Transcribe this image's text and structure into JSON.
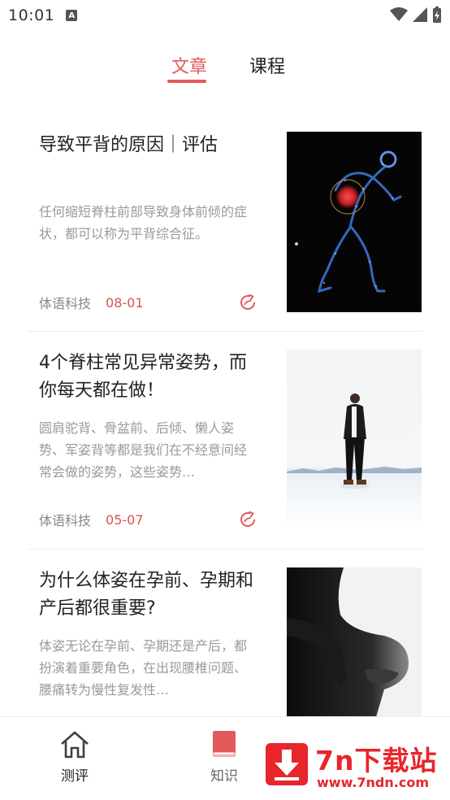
{
  "status_bar": {
    "time": "10:01",
    "notification_letter": "A"
  },
  "tabs": [
    {
      "label": "文章",
      "active": true
    },
    {
      "label": "课程",
      "active": false
    }
  ],
  "articles": [
    {
      "title": "导致平背的原因｜评估",
      "description": "任何缩短脊柱前部导致身体前倾的症状，都可以称为平背综合征。",
      "source": "体语科技",
      "date": "08-01",
      "thumbnail": "glowing-body-anatomy-image"
    },
    {
      "title": "4个脊柱常见异常姿势，而你每天都在做！",
      "description": "圆肩驼背、骨盆前、后倾、懒人姿势、军姿背等都是我们在不经意间经常会做的姿势，这些姿势…",
      "source": "体语科技",
      "date": "05-07",
      "thumbnail": "man-standing-on-snow-image"
    },
    {
      "title": "为什么体姿在孕前、孕期和产后都很重要?",
      "description": "体姿无论在孕前、孕期还是产后，都扮演着重要角色，在出现腰椎问题、腰痛转为慢性复发性…",
      "source": "",
      "date": "",
      "thumbnail": "pregnant-silhouette-image"
    }
  ],
  "bottom_nav": [
    {
      "label": "测评",
      "icon": "home-icon"
    },
    {
      "label": "知识",
      "icon": "book-icon"
    }
  ],
  "watermark": {
    "text": "7n下载站",
    "url": "www.7ndn.com"
  },
  "colors": {
    "accent": "#e25a5a",
    "date": "#d9534f",
    "watermark": "#e8252b"
  }
}
